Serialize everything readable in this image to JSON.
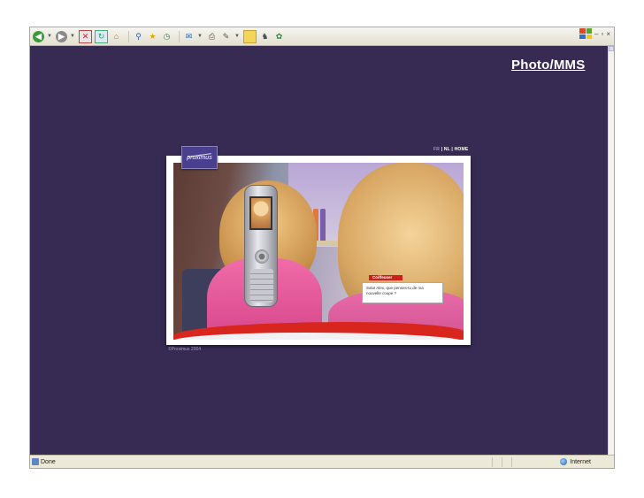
{
  "toolbar": {
    "icons": [
      "back-icon",
      "dropdown-arrow-icon",
      "forward-icon",
      "dropdown-arrow-icon",
      "stop-icon",
      "refresh-icon",
      "home-icon",
      "search-icon",
      "favorites-icon",
      "history-icon",
      "mail-icon",
      "dropdown-arrow-icon",
      "print-icon",
      "edit-icon",
      "dropdown-arrow-icon",
      "discuss-icon",
      "messenger-icon",
      "research-icon"
    ]
  },
  "window_controls": {
    "minimize": "–",
    "maximize": "▫",
    "close": "×"
  },
  "slide": {
    "title": "Photo/MMS"
  },
  "site": {
    "language_bar_fr": "FR",
    "language_bar_nl": "| NL |",
    "language_bar_home": "HOME",
    "logo_text": "proximus",
    "chat_title": "Coiffeuser",
    "chat_message": "Salut Alex, que penses-tu de ma nouvelle coupe ?",
    "copyright": "©Proximus 2004"
  },
  "statusbar": {
    "status_text": "Done",
    "zone_text": "Internet"
  },
  "colors": {
    "page_background": "#372b54",
    "accent_red": "#d8261f",
    "chrome": "#ece9d8"
  }
}
